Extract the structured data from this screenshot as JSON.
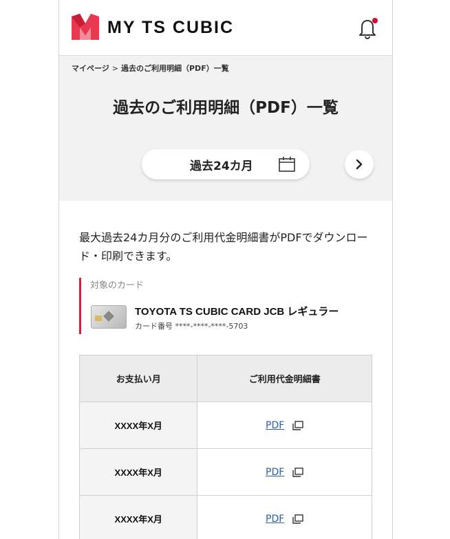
{
  "header": {
    "brand": "MY TS CUBIC",
    "logo_color": "#e8384f",
    "notification_dot_color": "#e5002d"
  },
  "breadcrumb": {
    "home": "マイページ",
    "separator": ">",
    "current": "過去のご利用明細（PDF）一覧"
  },
  "page_title": "過去のご利用明細（PDF）一覧",
  "period": {
    "label": "過去24カ月"
  },
  "description": "最大過去24カ月分のご利用代金明細書がPDFでダウンロード・印刷できます。",
  "card": {
    "heading": "対象のカード",
    "name": "TOYOTA TS CUBIC CARD JCB レギュラー",
    "number": "カード番号 ****-****-****-5703"
  },
  "table": {
    "headers": [
      "お支払い月",
      "ご利用代金明細書"
    ],
    "rows": [
      {
        "month": "XXXX年X月",
        "link": "PDF"
      },
      {
        "month": "XXXX年X月",
        "link": "PDF"
      },
      {
        "month": "XXXX年X月",
        "link": "PDF"
      }
    ]
  },
  "colors": {
    "accent": "#d5203c",
    "link": "#2b5fa6",
    "hero_bg": "#f2f2f2"
  }
}
